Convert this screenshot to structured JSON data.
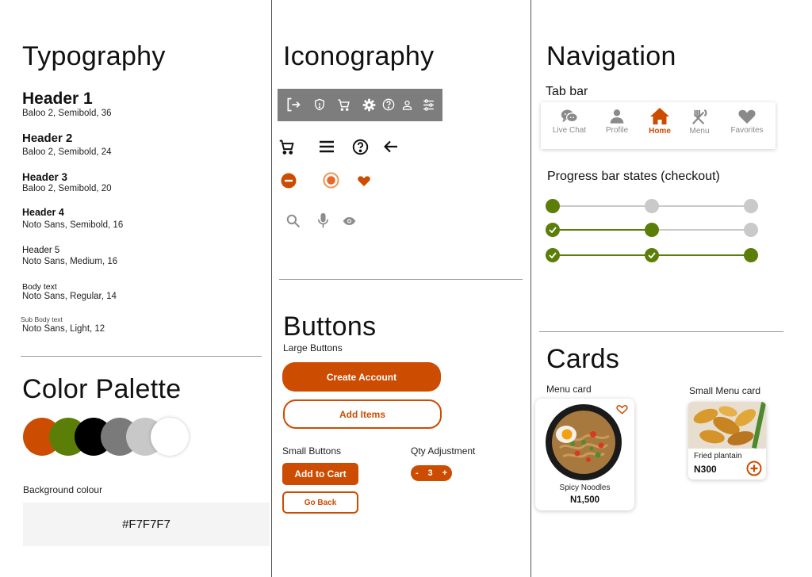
{
  "typography": {
    "title": "Typography",
    "items": [
      {
        "name": "Header 1",
        "spec": "Baloo 2, Semibold, 36"
      },
      {
        "name": "Header 2",
        "spec": "Baloo 2, Semibold, 24"
      },
      {
        "name": "Header 3",
        "spec": "Baloo 2, Semibold, 20"
      },
      {
        "name": "Header 4",
        "spec": "Noto Sans, Semibold, 16"
      },
      {
        "name": "Header 5",
        "spec": "Noto Sans, Medium, 16"
      },
      {
        "name": "Body text",
        "spec": "Noto Sans, Regular, 14"
      },
      {
        "name": "Sub Body text",
        "spec": "Noto Sans, Light, 12"
      }
    ]
  },
  "palette": {
    "title": "Color Palette",
    "colors": [
      "#cc4c02",
      "#5b7e08",
      "#000000",
      "#7a7a7a",
      "#c8c8c8",
      "#ffffff"
    ],
    "background_label": "Background colour",
    "background_hex": "#F7F7F7"
  },
  "iconography": {
    "title": "Iconography",
    "toolbar_bg": "#7d7d7d",
    "toolbar_icons": [
      "logout-icon",
      "shield-icon",
      "cart-icon",
      "gear-icon",
      "help-icon",
      "user-icon",
      "sliders-icon"
    ],
    "row1_icons": [
      "cart-icon",
      "menu-icon",
      "help-icon",
      "arrow-left-icon"
    ],
    "row2_icons": [
      "minus-circle-icon",
      "radio-selected-icon",
      "heart-icon"
    ],
    "row3_icons": [
      "search-icon",
      "mic-icon",
      "eye-icon"
    ]
  },
  "buttons": {
    "title": "Buttons",
    "large_label": "Large Buttons",
    "create_account": "Create Account",
    "add_items": "Add Items",
    "small_label": "Small Buttons",
    "add_to_cart": "Add to Cart",
    "go_back": "Go Back",
    "qty_label": "Qty Adjustment",
    "qty_minus": "-",
    "qty_value": "3",
    "qty_plus": "+"
  },
  "navigation": {
    "title": "Navigation",
    "tabbar_label": "Tab bar",
    "tabs": [
      {
        "label": "Live Chat",
        "icon": "chat-icon",
        "active": false
      },
      {
        "label": "Profile",
        "icon": "user-icon",
        "active": false
      },
      {
        "label": "Home",
        "icon": "home-icon",
        "active": true
      },
      {
        "label": "Menu",
        "icon": "utensils-icon",
        "active": false
      },
      {
        "label": "Favorites",
        "icon": "heart-icon",
        "active": false
      }
    ],
    "progress_label": "Progress bar states (checkout)",
    "progress_states": [
      1,
      2,
      3
    ]
  },
  "cards": {
    "title": "Cards",
    "menu_card_label": "Menu card",
    "menu_item_name": "Spicy Noodles",
    "menu_item_price": "N1,500",
    "small_card_label": "Small Menu card",
    "small_item_name": "Fried plantain",
    "small_item_price": "N300"
  },
  "colors": {
    "accent": "#cc4c02",
    "green": "#5b7e08",
    "grey": "#c9c9c9",
    "active_tab": "#cc4c02"
  }
}
